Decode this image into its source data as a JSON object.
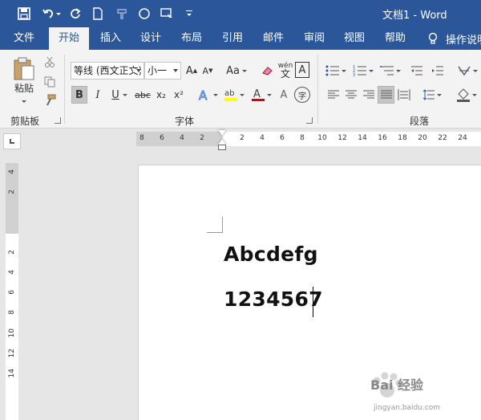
{
  "window": {
    "title": "文档1  -  Word"
  },
  "tabs": [
    {
      "label": "文件"
    },
    {
      "label": "开始"
    },
    {
      "label": "插入"
    },
    {
      "label": "设计"
    },
    {
      "label": "布局"
    },
    {
      "label": "引用"
    },
    {
      "label": "邮件"
    },
    {
      "label": "审阅"
    },
    {
      "label": "视图"
    },
    {
      "label": "帮助"
    }
  ],
  "tell_me": "操作说明",
  "ribbon": {
    "clipboard": {
      "paste_label": "粘贴",
      "group_label": "剪贴板"
    },
    "font": {
      "font_name": "等线 (西文正文)",
      "font_size": "小一",
      "change_case": "Aa",
      "bold": "B",
      "italic": "I",
      "underline": "U",
      "strikethrough": "abc",
      "subscript": "x₂",
      "superscript": "x²",
      "group_label": "字体",
      "phonetic_guide": "wén",
      "enclose": "字",
      "char_border": "A"
    },
    "paragraph": {
      "group_label": "段落"
    }
  },
  "ruler": {
    "h_numbers": [
      "8",
      "6",
      "4",
      "2",
      "2",
      "4",
      "6",
      "8",
      "10",
      "12",
      "14",
      "16",
      "18",
      "20",
      "22",
      "24"
    ],
    "v_numbers": [
      "4",
      "2",
      "2",
      "4",
      "6",
      "8",
      "10",
      "12",
      "14"
    ]
  },
  "document": {
    "lines": [
      "Abcdefg",
      "1234567"
    ]
  },
  "watermark": {
    "text": "Bai 经验",
    "sub": "jingyan.baidu.com"
  },
  "colors": {
    "title_bar": "#2b579a",
    "ribbon_bg": "#f3f3f3",
    "highlight_yellow": "#ffff00",
    "font_color_red": "#e00000"
  }
}
